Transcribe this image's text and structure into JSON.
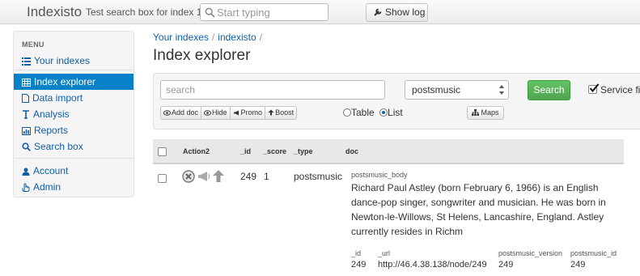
{
  "navbar": {
    "brand": "Indexisto",
    "search_label": "Test search box for index 1:",
    "search_placeholder": "Start typing",
    "show_log_label": "Show log"
  },
  "sidebar": {
    "menu_header": "MENU",
    "items": [
      {
        "label": "Your indexes",
        "icon": "list-icon",
        "active": false
      },
      {
        "label": "Index explorer",
        "icon": "table-icon",
        "active": true
      },
      {
        "label": "Data import",
        "icon": "file-icon",
        "active": false
      },
      {
        "label": "Analysis",
        "icon": "text-height-icon",
        "active": false
      },
      {
        "label": "Reports",
        "icon": "bar-chart-icon",
        "active": false
      },
      {
        "label": "Search box",
        "icon": "search-icon",
        "active": false
      },
      {
        "label": "Account",
        "icon": "user-icon",
        "active": false
      },
      {
        "label": "Admin",
        "icon": "hand-icon",
        "active": false
      }
    ]
  },
  "breadcrumb": {
    "items": [
      "Your indexes",
      "indexisto"
    ],
    "separator": "/"
  },
  "page_title": "Index explorer",
  "search_panel": {
    "search_placeholder": "search",
    "type_select_value": "postsmusic",
    "search_button": "Search",
    "service_fields_label": "Service fie",
    "service_fields_checked": true,
    "action_buttons": [
      "Add doc",
      "Hide",
      "Promo",
      "Boost"
    ],
    "view_options": [
      "Table",
      "List"
    ],
    "view_selected": "List",
    "maps_button": "Maps"
  },
  "table": {
    "headers": [
      "Action2",
      "_id",
      "_score",
      "_type",
      "doc"
    ],
    "rows": [
      {
        "id": "249",
        "score": "1",
        "type": "postsmusic",
        "doc_title_key": "postsmusic_body",
        "doc_body": "Richard Paul Astley (born February 6, 1966) is an English dance-pop singer, songwriter and musician. He was born in Newton-le-Willows, St Helens, Lancashire, England. Astley currently resides in Richm",
        "fields": [
          {
            "key": "_id",
            "value": "249"
          },
          {
            "key": "_url",
            "value": "http://46.4.38.138/node/249"
          },
          {
            "key": "postsmusic_version",
            "value": "249"
          },
          {
            "key": "postsmusic_id",
            "value": "249"
          }
        ]
      }
    ]
  },
  "colors": {
    "link": "#0f5ea8",
    "active_nav": "#0881c8",
    "search_button": "#5bb75b"
  }
}
